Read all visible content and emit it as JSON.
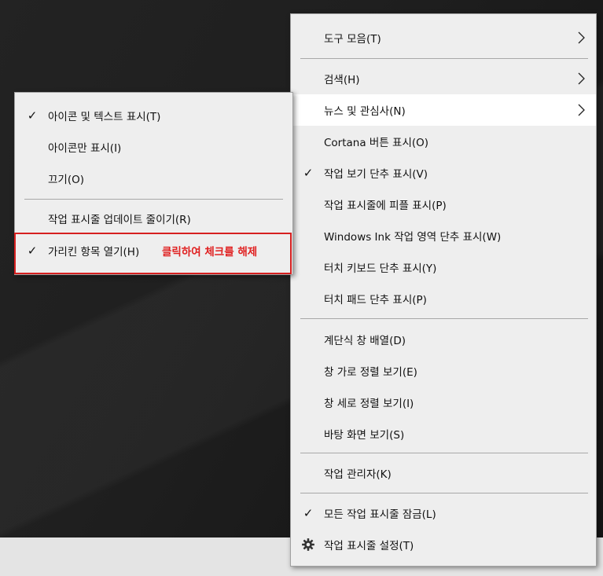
{
  "main_menu": {
    "items": [
      {
        "label": "도구 모음(T)",
        "submenu": true
      },
      {
        "label": "검색(H)",
        "submenu": true
      },
      {
        "label": "뉴스 및 관심사(N)",
        "submenu": true,
        "highlighted": true
      },
      {
        "label": "Cortana 버튼 표시(O)"
      },
      {
        "label": "작업 보기 단추 표시(V)",
        "checked": true
      },
      {
        "label": "작업 표시줄에 피플 표시(P)"
      },
      {
        "label": "Windows Ink 작업 영역 단추 표시(W)"
      },
      {
        "label": "터치 키보드 단추 표시(Y)"
      },
      {
        "label": "터치 패드 단추 표시(P)"
      },
      {
        "label": "계단식 창 배열(D)"
      },
      {
        "label": "창 가로 정렬 보기(E)"
      },
      {
        "label": "창 세로 정렬 보기(I)"
      },
      {
        "label": "바탕 화면 보기(S)"
      },
      {
        "label": "작업 관리자(K)"
      },
      {
        "label": "모든 작업 표시줄 잠금(L)",
        "checked": true
      },
      {
        "label": "작업 표시줄 설정(T)",
        "icon": "gear-icon"
      }
    ]
  },
  "sub_menu": {
    "items": [
      {
        "label": "아이콘 및 텍스트 표시(T)",
        "checked": true
      },
      {
        "label": "아이콘만 표시(I)"
      },
      {
        "label": "끄기(O)"
      },
      {
        "label": "작업 표시줄 업데이트 줄이기(R)"
      },
      {
        "label": "가리킨 항목 열기(H)",
        "checked": true
      }
    ],
    "annotation": "클릭하여 체크를 해제"
  },
  "colors": {
    "menu_bg": "#eeeeee",
    "highlight": "#ffffff",
    "annotation_red": "#d62020"
  }
}
